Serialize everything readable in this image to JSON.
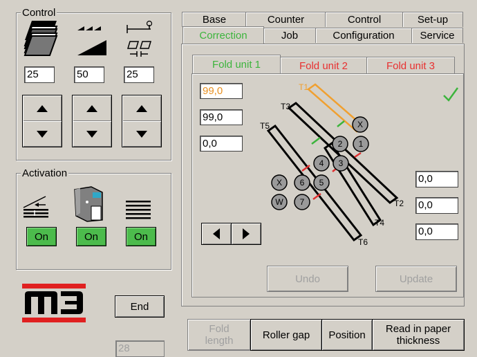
{
  "control": {
    "title": "Control",
    "fields": [
      "25",
      "50",
      "25"
    ]
  },
  "activation": {
    "title": "Activation",
    "buttons": [
      "On",
      "On",
      "On"
    ]
  },
  "end_label": "End",
  "counter_value": "28",
  "top_tabs_row1": [
    "Base",
    "Counter",
    "Control",
    "Set-up"
  ],
  "top_tabs_row2": [
    "Correction",
    "Job",
    "Configuration",
    "Service"
  ],
  "fold_tabs": [
    "Fold unit 1",
    "Fold unit 2",
    "Fold unit 3"
  ],
  "left_fields": [
    "99,0",
    "99,0",
    "0,0"
  ],
  "right_fields": [
    "0,0",
    "0,0",
    "0,0"
  ],
  "diagram": {
    "labels": [
      "T1",
      "T3",
      "T5",
      "T2",
      "T4",
      "T6"
    ],
    "rollers": [
      "X",
      "2",
      "1",
      "4",
      "3",
      "X",
      "6",
      "5",
      "W",
      "7"
    ]
  },
  "undo_label": "Undo",
  "update_label": "Update",
  "bottom_buttons": [
    "Fold\nlength",
    "Roller gap",
    "Position",
    "Read in paper\nthickness"
  ],
  "colors": {
    "active_tab": "#3cb43c",
    "fold_tab": "#e83030",
    "highlight_value": "#e89020",
    "check": "#3cb43c",
    "on_button": "#4cbb4c"
  }
}
